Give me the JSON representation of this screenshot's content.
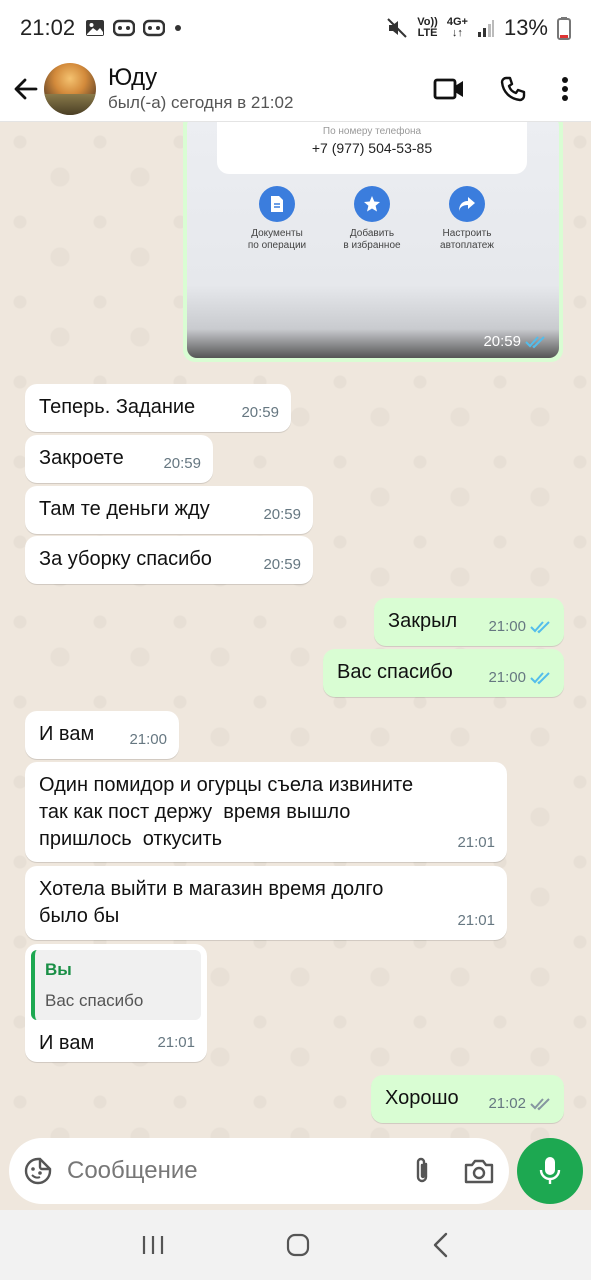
{
  "status_bar": {
    "time": "21:02",
    "battery": "13%",
    "net_top": "Vo))",
    "net_bottom": "LTE",
    "gen_top": "4G+",
    "gen_bottom": "↓↑"
  },
  "header": {
    "contact_name": "Юду",
    "last_seen": "был(-а) сегодня в 21:02"
  },
  "image_message": {
    "card_label": "По номеру телефона",
    "card_value": "+7 (977) 504-53-85",
    "actions": [
      {
        "label": "Документы\nпо операции"
      },
      {
        "label": "Добавить\nв избранное"
      },
      {
        "label": "Настроить\nавтоплатеж"
      }
    ],
    "time": "20:59"
  },
  "messages": [
    {
      "text": "Теперь. Задание",
      "time": "20:59"
    },
    {
      "text": "Закроете",
      "time": "20:59"
    },
    {
      "text": "Там те деньги жду",
      "time": "20:59"
    },
    {
      "text": "За уборку спасибо",
      "time": "20:59"
    },
    {
      "text": "Закрыл",
      "time": "21:00"
    },
    {
      "text": "Вас спасибо",
      "time": "21:00"
    },
    {
      "text": "И вам",
      "time": "21:00"
    },
    {
      "text": "Один помидор и огурцы съела извините\nтак как пост держу  время вышло\nпришлось  откусить",
      "time": "21:01"
    },
    {
      "text": "Хотела выйти в магазин время долго\nбыло бы",
      "time": "21:01"
    },
    {
      "quote_author": "Вы",
      "quote_text": "Вас спасибо",
      "text": "И вам",
      "time": "21:01"
    },
    {
      "text": "Хорошо",
      "time": "21:02"
    }
  ],
  "input": {
    "placeholder": "Сообщение"
  },
  "colors": {
    "outgoing_bubble": "#d9fdd3",
    "incoming_bubble": "#ffffff",
    "accent_green": "#1da851",
    "read_tick_blue": "#53bdeb"
  }
}
